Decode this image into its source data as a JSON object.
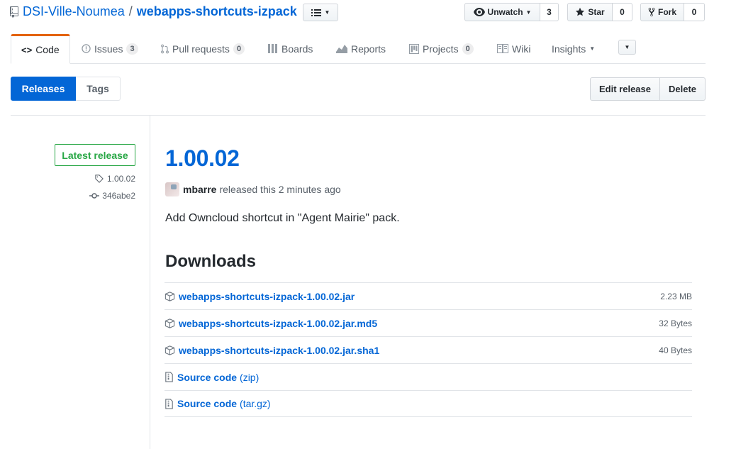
{
  "repo": {
    "owner": "DSI-Ville-Noumea",
    "separator": "/",
    "name": "webapps-shortcuts-izpack"
  },
  "actions": {
    "watch": {
      "label": "Unwatch",
      "count": "3"
    },
    "star": {
      "label": "Star",
      "count": "0"
    },
    "fork": {
      "label": "Fork",
      "count": "0"
    }
  },
  "tabs": [
    {
      "label": "Code",
      "icon": "code-icon"
    },
    {
      "label": "Issues",
      "count": "3",
      "icon": "issue-icon"
    },
    {
      "label": "Pull requests",
      "count": "0",
      "icon": "pull-request-icon"
    },
    {
      "label": "Boards",
      "icon": "boards-icon"
    },
    {
      "label": "Reports",
      "icon": "graph-icon"
    },
    {
      "label": "Projects",
      "count": "0",
      "icon": "project-icon"
    },
    {
      "label": "Wiki",
      "icon": "book-icon"
    },
    {
      "label": "Insights",
      "icon": "chevron-down-icon"
    }
  ],
  "subnav": {
    "releases": "Releases",
    "tags": "Tags"
  },
  "release_actions": {
    "edit": "Edit release",
    "delete": "Delete"
  },
  "release": {
    "badge": "Latest release",
    "tag": "1.00.02",
    "commit": "346abe2",
    "title": "1.00.02",
    "author": "mbarre",
    "released_text": "released this 2 minutes ago",
    "description": "Add Owncloud shortcut in \"Agent Mairie\" pack."
  },
  "downloads": {
    "heading": "Downloads",
    "files": [
      {
        "name": "webapps-shortcuts-izpack-1.00.02.jar",
        "size": "2.23 MB"
      },
      {
        "name": "webapps-shortcuts-izpack-1.00.02.jar.md5",
        "size": "32 Bytes"
      },
      {
        "name": "webapps-shortcuts-izpack-1.00.02.jar.sha1",
        "size": "40 Bytes"
      }
    ],
    "sources": [
      {
        "label": "Source code",
        "format": "(zip)"
      },
      {
        "label": "Source code",
        "format": "(tar.gz)"
      }
    ]
  }
}
